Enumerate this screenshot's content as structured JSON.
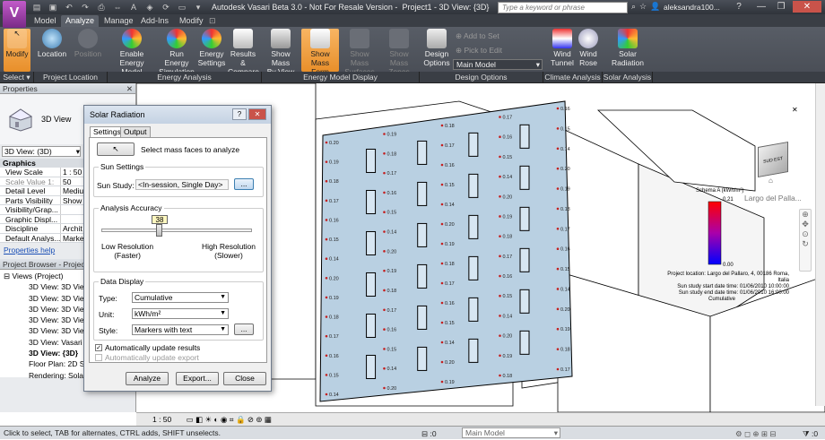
{
  "app": {
    "logo_letter": "V",
    "title": "Autodesk Vasari Beta 3.0 - Not For Resale Version -",
    "doc": "Project1 - 3D View: {3D}",
    "search_placeholder": "Type a keyword or phrase",
    "user": "aleksandra100..."
  },
  "tabs": [
    "Model",
    "Analyze",
    "Manage",
    "Add-Ins",
    "Modify"
  ],
  "active_tab": "Analyze",
  "ribbon": {
    "buttons": [
      {
        "label": "Modify",
        "label2": "",
        "state": "highlight",
        "icon": "cursor-icon"
      },
      {
        "label": "Location",
        "label2": "",
        "state": "normal",
        "icon": "location-icon"
      },
      {
        "label": "Position",
        "label2": "",
        "state": "disabled",
        "icon": "position-icon"
      },
      {
        "label": "Enable Energy",
        "label2": "Model",
        "state": "normal",
        "icon": "energy-model-icon"
      },
      {
        "label": "Run Energy",
        "label2": "Simulation",
        "state": "normal",
        "icon": "run-simulation-icon"
      },
      {
        "label": "Energy",
        "label2": "Settings",
        "state": "normal",
        "icon": "energy-settings-icon"
      },
      {
        "label": "Results &",
        "label2": "Compare",
        "state": "normal",
        "icon": "results-icon"
      },
      {
        "label": "Show Mass",
        "label2": "By View",
        "state": "normal",
        "icon": "mass-by-view-icon"
      },
      {
        "label": "Show Mass",
        "label2": "Form",
        "state": "highlight",
        "icon": "mass-form-icon"
      },
      {
        "label": "Show Mass",
        "label2": "Surfaces",
        "state": "disabled",
        "icon": "mass-surfaces-icon"
      },
      {
        "label": "Show Mass",
        "label2": "Zones",
        "state": "disabled",
        "icon": "mass-zones-icon"
      },
      {
        "label": "Design",
        "label2": "Options",
        "state": "normal",
        "icon": "design-options-icon"
      },
      {
        "label": "Wind",
        "label2": "Tunnel",
        "state": "normal",
        "icon": "wind-tunnel-icon"
      },
      {
        "label": "Wind",
        "label2": "Rose",
        "state": "normal",
        "icon": "wind-rose-icon"
      },
      {
        "label": "Solar",
        "label2": "Radiation",
        "state": "normal",
        "icon": "solar-radiation-icon"
      }
    ],
    "small": {
      "add_to_set": "Add to Set",
      "pick_to_edit": "Pick to Edit",
      "main_model": "Main Model"
    },
    "groups": [
      "Select ▾",
      "Project Location",
      "Energy Analysis",
      "Energy Model Display",
      "Design Options",
      "Climate Analysis",
      "Solar Analysis"
    ]
  },
  "properties": {
    "header": "Properties",
    "type_name": "3D View",
    "selector": "3D View: (3D)",
    "group": "Graphics",
    "rows": [
      {
        "k": "View Scale",
        "v": "1 : 50"
      },
      {
        "k": "Scale Value  1:",
        "v": "50"
      },
      {
        "k": "Detail Level",
        "v": "Mediu"
      },
      {
        "k": "Parts Visibility",
        "v": "Show"
      },
      {
        "k": "Visibility/Grap...",
        "v": ""
      },
      {
        "k": "Graphic Displ...",
        "v": ""
      },
      {
        "k": "Discipline",
        "v": "Archit"
      },
      {
        "k": "Default Analys...",
        "v": "Marke"
      }
    ],
    "help_link": "Properties help"
  },
  "project_browser": {
    "header": "Project Browser - Project1",
    "items": [
      {
        "label": "Views (Project)",
        "indent": 0,
        "bold": false
      },
      {
        "label": "3D View: 3D View",
        "indent": 1,
        "bold": false
      },
      {
        "label": "3D View: 3D View",
        "indent": 1,
        "bold": false
      },
      {
        "label": "3D View: 3D View",
        "indent": 1,
        "bold": false
      },
      {
        "label": "3D View: 3D View",
        "indent": 1,
        "bold": false
      },
      {
        "label": "3D View: 3D View",
        "indent": 1,
        "bold": false
      },
      {
        "label": "3D View: Vasari 3",
        "indent": 1,
        "bold": false
      },
      {
        "label": "3D View: {3D}",
        "indent": 1,
        "bold": true
      },
      {
        "label": "Floor Plan: 2D Site",
        "indent": 1,
        "bold": false
      },
      {
        "label": "Rendering: SolarRadiationStu",
        "indent": 1,
        "bold": false
      }
    ]
  },
  "dialog": {
    "title": "Solar Radiation",
    "tabs": [
      "Settings",
      "Output"
    ],
    "select_faces": "Select mass faces to analyze",
    "sun_settings_legend": "Sun Settings",
    "sun_study_label": "Sun Study:",
    "sun_study_value": "<In-session, Single Day>",
    "ellipsis": "...",
    "accuracy_legend": "Analysis Accuracy",
    "accuracy_value": "38",
    "accuracy_fraction": 0.38,
    "low_label": "Low  Resolution",
    "low_sub": "(Faster)",
    "high_label": "High Resolution",
    "high_sub": "(Slower)",
    "data_display_legend": "Data Display",
    "type_label": "Type:",
    "type_value": "Cumulative",
    "unit_label": "Unit:",
    "unit_value": "kWh/m²",
    "style_label": "Style:",
    "style_value": "Markers with text",
    "auto_update_results": "Automatically update results",
    "auto_update_results_checked": true,
    "auto_update_export": "Automatically update export",
    "auto_update_export_checked": false,
    "analyze_btn": "Analyze",
    "export_btn": "Export...",
    "close_btn": "Close"
  },
  "viewport": {
    "legend_title": "Schema A (kWh/m²)",
    "legend_max": "0.21",
    "legend_min": "0.00",
    "location_label": "Largo del Palla...",
    "info_lines": [
      "Project location: Largo del Pallaro, 4, 00186 Roma, Italia",
      "Sun study start date time: 01/06/2010 10:00:00",
      "Sun study end date time: 01/06/2010 16:00:00"
    ],
    "cumulative": "Cumulative",
    "view_scale": "1 : 50",
    "cube_labels": [
      "SUD",
      "EST"
    ],
    "marker_labels": [
      "0.20",
      "0.19",
      "0.18",
      "0.17",
      "0.16",
      "0.15",
      "0.14",
      "0.21"
    ]
  },
  "status": {
    "text": "Click to select, TAB for alternates, CTRL adds, SHIFT unselects.",
    "model": "Main Model",
    "zero": ":0"
  },
  "colors": {
    "ribbon_dark": "#474b53",
    "highlight": "#f0a84a",
    "facade": "#b9d0e2",
    "legend_top": "#ff0000",
    "legend_bottom": "#0000ff"
  }
}
